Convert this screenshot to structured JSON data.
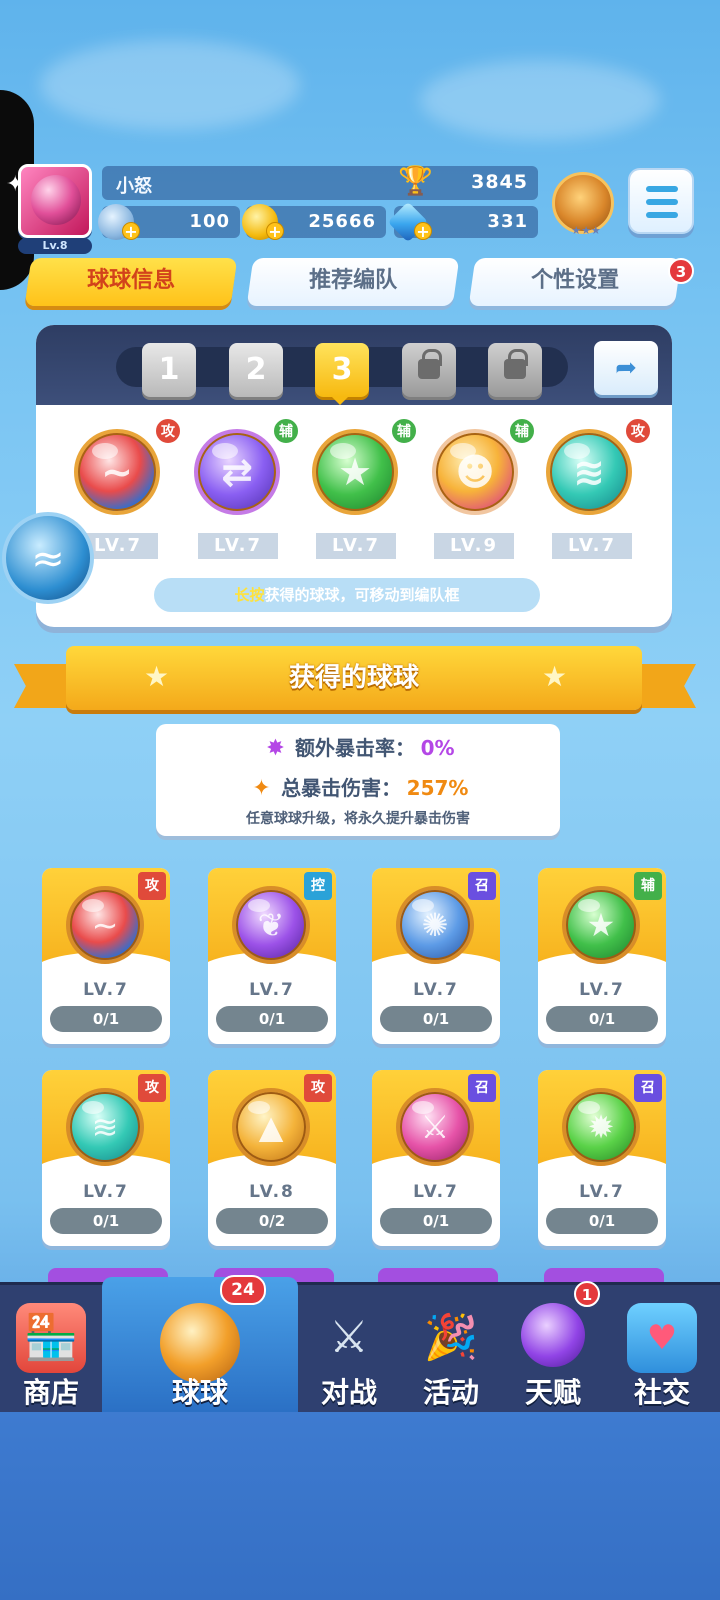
{
  "player": {
    "name": "小怒",
    "level": "Lv.8",
    "trophies": "3845",
    "energy": "100",
    "coins": "25666",
    "gems": "331"
  },
  "tabs": [
    {
      "label": "球球信息",
      "active": true
    },
    {
      "label": "推荐编队",
      "active": false
    },
    {
      "label": "个性设置",
      "active": false,
      "badge": "3"
    }
  ],
  "lineup": {
    "slots": [
      "1",
      "2",
      "3"
    ],
    "selected": "3",
    "balls": [
      {
        "tag": "攻",
        "level": "LV.7"
      },
      {
        "tag": "辅",
        "level": "LV.7"
      },
      {
        "tag": "辅",
        "level": "LV.7"
      },
      {
        "tag": "辅",
        "level": "LV.9"
      },
      {
        "tag": "攻",
        "level": "LV.7"
      }
    ],
    "hint_highlight": "长按",
    "hint_rest": "获得的球球，可移动到编队框"
  },
  "section_title": "获得的球球",
  "stats": {
    "crit_rate_label": "额外暴击率：",
    "crit_rate_value": "0%",
    "crit_damage_label": "总暴击伤害：",
    "crit_damage_value": "257%",
    "note": "任意球球升级，将永久提升暴击伤害"
  },
  "collection": [
    {
      "tag": "攻",
      "level": "LV.7",
      "progress": "0/1"
    },
    {
      "tag": "控",
      "level": "LV.7",
      "progress": "0/1"
    },
    {
      "tag": "召",
      "level": "LV.7",
      "progress": "0/1"
    },
    {
      "tag": "辅",
      "level": "LV.7",
      "progress": "0/1"
    },
    {
      "tag": "攻",
      "level": "LV.7",
      "progress": "0/1"
    },
    {
      "tag": "攻",
      "level": "LV.8",
      "progress": "0/2"
    },
    {
      "tag": "召",
      "level": "LV.7",
      "progress": "0/1"
    },
    {
      "tag": "召",
      "level": "LV.7",
      "progress": "0/1"
    }
  ],
  "nav": [
    {
      "label": "商店",
      "icon": "shop-icon"
    },
    {
      "label": "球球",
      "icon": "balls-icon",
      "badge": "24",
      "active": true
    },
    {
      "label": "对战",
      "icon": "battle-icon"
    },
    {
      "label": "活动",
      "icon": "event-icon"
    },
    {
      "label": "天赋",
      "icon": "talent-icon",
      "badge": "1"
    },
    {
      "label": "社交",
      "icon": "social-icon"
    }
  ],
  "colors": {
    "accent_yellow": "#ffc21a",
    "attack_tag": "#e04a3a",
    "support_tag": "#43b04a",
    "control_tag": "#2aa2d8",
    "summon_tag": "#6a4fe0",
    "nav_bg": "#2f4070"
  }
}
